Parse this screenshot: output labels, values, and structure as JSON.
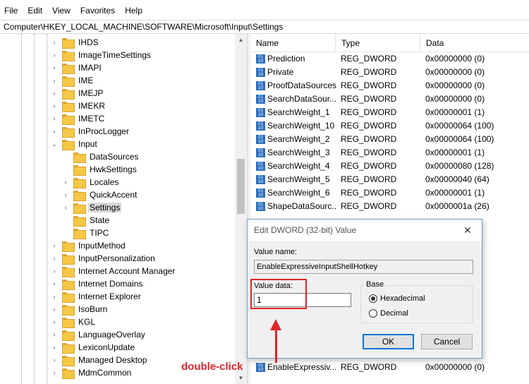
{
  "menu": [
    "File",
    "Edit",
    "View",
    "Favorites",
    "Help"
  ],
  "address": "Computer\\HKEY_LOCAL_MACHINE\\SOFTWARE\\Microsoft\\Input\\Settings",
  "tree": {
    "items": [
      {
        "label": "IHDS",
        "expander": "›",
        "depth": 0
      },
      {
        "label": "ImageTimeSettings",
        "expander": "›",
        "depth": 0
      },
      {
        "label": "IMAPI",
        "expander": "›",
        "depth": 0
      },
      {
        "label": "IME",
        "expander": "›",
        "depth": 0
      },
      {
        "label": "IMEJP",
        "expander": "›",
        "depth": 0
      },
      {
        "label": "IMEKR",
        "expander": "›",
        "depth": 0
      },
      {
        "label": "IMETC",
        "expander": "›",
        "depth": 0
      },
      {
        "label": "InProcLogger",
        "expander": "›",
        "depth": 0
      },
      {
        "label": "Input",
        "expander": "⌄",
        "depth": 0
      },
      {
        "label": "DataSources",
        "expander": "",
        "depth": 1
      },
      {
        "label": "HwkSettings",
        "expander": "",
        "depth": 1
      },
      {
        "label": "Locales",
        "expander": "›",
        "depth": 1
      },
      {
        "label": "QuickAccent",
        "expander": "›",
        "depth": 1
      },
      {
        "label": "Settings",
        "expander": "›",
        "depth": 1,
        "selected": true
      },
      {
        "label": "State",
        "expander": "",
        "depth": 1
      },
      {
        "label": "TIPC",
        "expander": "",
        "depth": 1
      },
      {
        "label": "InputMethod",
        "expander": "›",
        "depth": 0
      },
      {
        "label": "InputPersonalization",
        "expander": "›",
        "depth": 0
      },
      {
        "label": "Internet Account Manager",
        "expander": "›",
        "depth": 0
      },
      {
        "label": "Internet Domains",
        "expander": "›",
        "depth": 0
      },
      {
        "label": "Internet Explorer",
        "expander": "›",
        "depth": 0
      },
      {
        "label": "IsoBurn",
        "expander": "›",
        "depth": 0
      },
      {
        "label": "KGL",
        "expander": "›",
        "depth": 0
      },
      {
        "label": "LanguageOverlay",
        "expander": "›",
        "depth": 0
      },
      {
        "label": "LexiconUpdate",
        "expander": "›",
        "depth": 0
      },
      {
        "label": "Managed Desktop",
        "expander": "›",
        "depth": 0
      },
      {
        "label": "MdmCommon",
        "expander": "›",
        "depth": 0
      }
    ]
  },
  "columns": {
    "name": "Name",
    "type": "Type",
    "data": "Data"
  },
  "values": [
    {
      "name": "Prediction",
      "type": "REG_DWORD",
      "data": "0x00000000 (0)"
    },
    {
      "name": "Private",
      "type": "REG_DWORD",
      "data": "0x00000000 (0)"
    },
    {
      "name": "ProofDataSources",
      "type": "REG_DWORD",
      "data": "0x00000000 (0)"
    },
    {
      "name": "SearchDataSour...",
      "type": "REG_DWORD",
      "data": "0x00000000 (0)"
    },
    {
      "name": "SearchWeight_1",
      "type": "REG_DWORD",
      "data": "0x00000001 (1)"
    },
    {
      "name": "SearchWeight_10",
      "type": "REG_DWORD",
      "data": "0x00000064 (100)"
    },
    {
      "name": "SearchWeight_2",
      "type": "REG_DWORD",
      "data": "0x00000064 (100)"
    },
    {
      "name": "SearchWeight_3",
      "type": "REG_DWORD",
      "data": "0x00000001 (1)"
    },
    {
      "name": "SearchWeight_4",
      "type": "REG_DWORD",
      "data": "0x00000080 (128)"
    },
    {
      "name": "SearchWeight_5",
      "type": "REG_DWORD",
      "data": "0x00000040 (64)"
    },
    {
      "name": "SearchWeight_6",
      "type": "REG_DWORD",
      "data": "0x00000001 (1)"
    },
    {
      "name": "ShapeDataSourc...",
      "type": "REG_DWORD",
      "data": "0x0000001a (26)"
    }
  ],
  "last_value": {
    "name": "EnableExpressiv...",
    "type": "REG_DWORD",
    "data": "0x00000000 (0)"
  },
  "dialog": {
    "title": "Edit DWORD (32-bit) Value",
    "close": "✕",
    "value_name_label": "Value name:",
    "value_name": "EnableExpressiveInputShellHotkey",
    "value_data_label": "Value data:",
    "value_data": "1",
    "base_label": "Base",
    "hex_label": "Hexadecimal",
    "dec_label": "Decimal",
    "ok": "OK",
    "cancel": "Cancel"
  },
  "annotation": "double-click",
  "colors": {
    "highlight": "#e0242a",
    "folder": "#f5c746",
    "reg_icon": "#2c6fbf"
  }
}
